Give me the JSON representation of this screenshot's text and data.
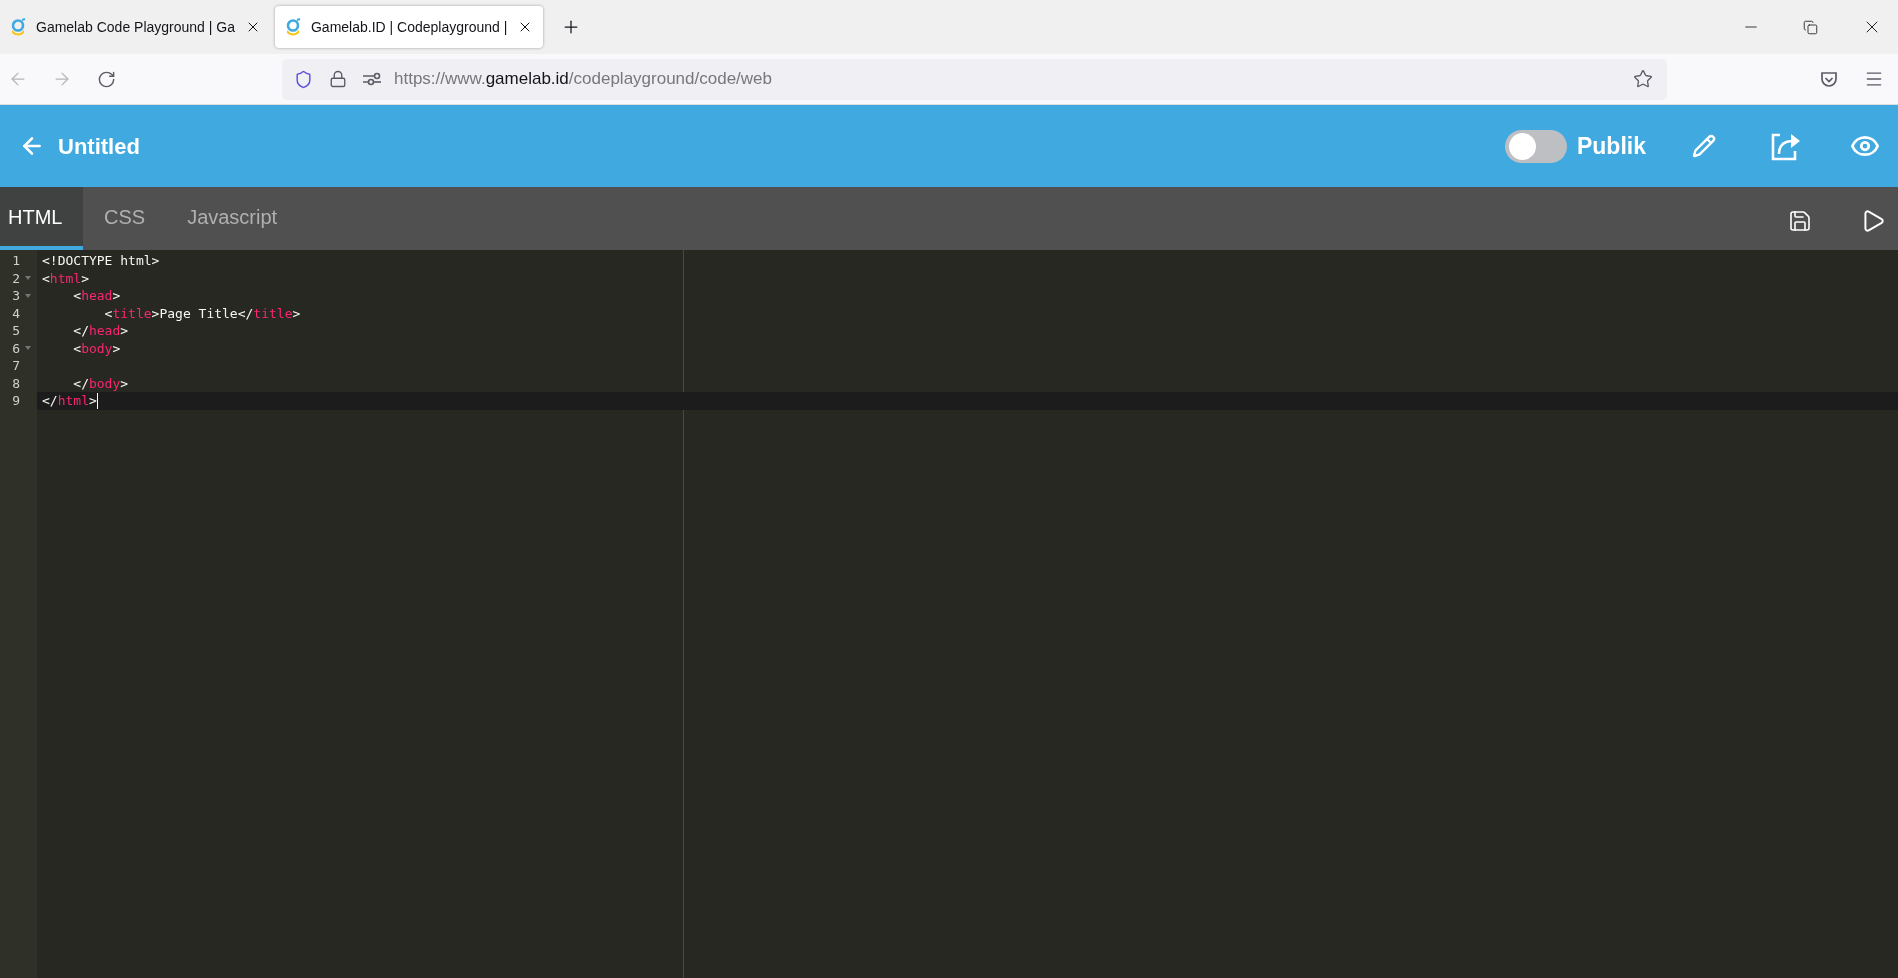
{
  "browser": {
    "tabs": [
      {
        "title": "Gamelab Code Playground | Ga",
        "selected": false
      },
      {
        "title": "Gamelab.ID | Codeplayground |",
        "selected": true
      }
    ],
    "url": {
      "scheme": "https://www.",
      "domain": "gamelab.id",
      "path": "/codeplayground/code/web"
    }
  },
  "header": {
    "title": "Untitled",
    "public_toggle": {
      "label": "Publik",
      "on": false
    }
  },
  "editor_tabs": [
    {
      "label": "HTML",
      "selected": true
    },
    {
      "label": "CSS",
      "selected": false
    },
    {
      "label": "Javascript",
      "selected": false
    }
  ],
  "code_lines": [
    {
      "number": "1",
      "foldable": false,
      "current": false,
      "segments": [
        {
          "kind": "plain",
          "text": "<!DOCTYPE html>"
        }
      ]
    },
    {
      "number": "2",
      "foldable": true,
      "current": false,
      "segments": [
        {
          "kind": "plain",
          "text": "<"
        },
        {
          "kind": "tag",
          "text": "html"
        },
        {
          "kind": "plain",
          "text": ">"
        }
      ]
    },
    {
      "number": "3",
      "foldable": true,
      "current": false,
      "segments": [
        {
          "kind": "plain",
          "text": "    <"
        },
        {
          "kind": "tag",
          "text": "head"
        },
        {
          "kind": "plain",
          "text": ">"
        }
      ]
    },
    {
      "number": "4",
      "foldable": false,
      "current": false,
      "segments": [
        {
          "kind": "plain",
          "text": "        <"
        },
        {
          "kind": "tag",
          "text": "title"
        },
        {
          "kind": "plain",
          "text": ">Page Title</"
        },
        {
          "kind": "tag",
          "text": "title"
        },
        {
          "kind": "plain",
          "text": ">"
        }
      ]
    },
    {
      "number": "5",
      "foldable": false,
      "current": false,
      "segments": [
        {
          "kind": "plain",
          "text": "    </"
        },
        {
          "kind": "tag",
          "text": "head"
        },
        {
          "kind": "plain",
          "text": ">"
        }
      ]
    },
    {
      "number": "6",
      "foldable": true,
      "current": false,
      "segments": [
        {
          "kind": "plain",
          "text": "    <"
        },
        {
          "kind": "tag",
          "text": "body"
        },
        {
          "kind": "plain",
          "text": ">"
        }
      ]
    },
    {
      "number": "7",
      "foldable": false,
      "current": false
    },
    {
      "number": "8",
      "foldable": false,
      "current": false,
      "segments": [
        {
          "kind": "plain",
          "text": "    </"
        },
        {
          "kind": "tag",
          "text": "body"
        },
        {
          "kind": "plain",
          "text": ">"
        }
      ]
    },
    {
      "number": "9",
      "foldable": false,
      "current": true,
      "segments": [
        {
          "kind": "plain",
          "text": "</"
        },
        {
          "kind": "tag",
          "text": "html"
        },
        {
          "kind": "plain",
          "text": ">"
        }
      ]
    }
  ]
}
